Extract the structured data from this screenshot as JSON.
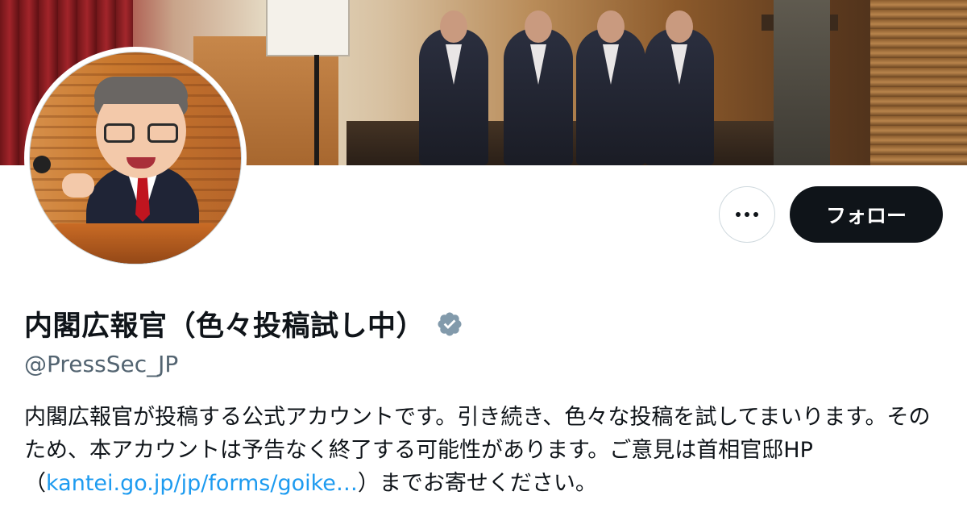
{
  "profile": {
    "display_name": "内閣広報官（色々投稿試し中）",
    "handle": "@PressSec_JP",
    "verified_icon": "verified-badge-icon",
    "bio_part1": "内閣広報官が投稿する公式アカウントです。引き続き、色々な投稿を試してまいります。そのため、本アカウントは予告なく終了する可能性があります。ご意見は首相官邸HP（",
    "bio_link": "kantei.go.jp/jp/forms/goike…",
    "bio_part2": "）までお寄せください。"
  },
  "actions": {
    "more_icon": "more-horizontal-icon",
    "follow_label": "フォロー"
  },
  "colors": {
    "text_primary": "#0f1419",
    "text_secondary": "#536471",
    "link": "#1d9bf0",
    "verified_badge": "#829aab",
    "follow_button_bg": "#0f1419"
  }
}
